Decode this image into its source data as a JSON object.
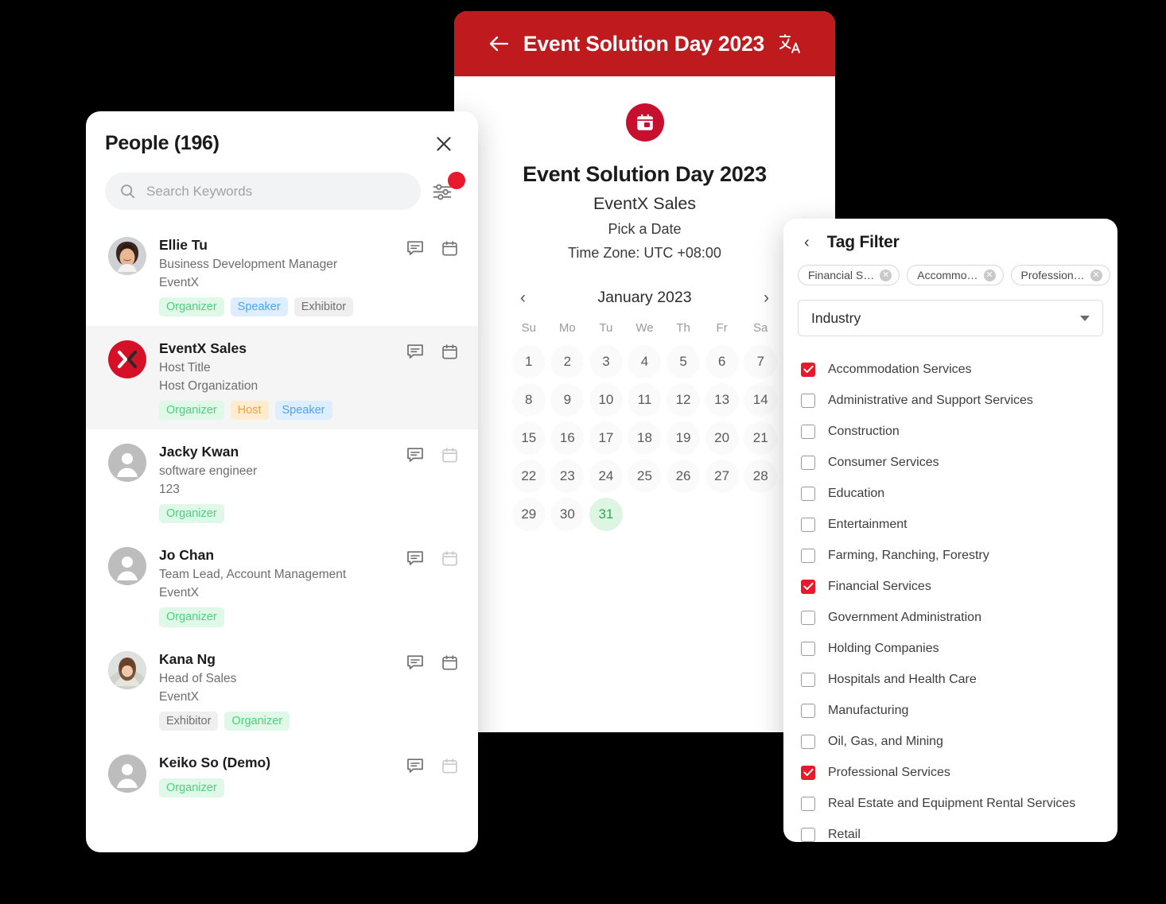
{
  "people_panel": {
    "title": "People (196)",
    "close_icon": "close-icon",
    "search": {
      "placeholder": "Search Keywords",
      "value": "",
      "icon": "search-icon",
      "filter_icon": "sliders-filter-icon",
      "filter_badge": true
    },
    "people": [
      {
        "name": "Ellie Tu",
        "title": "Business Development Manager",
        "org": "EventX",
        "avatar": "photo",
        "highlight": false,
        "tags": [
          {
            "label": "Organizer",
            "kind": "organizer"
          },
          {
            "label": "Speaker",
            "kind": "speaker"
          },
          {
            "label": "Exhibitor",
            "kind": "exhibitor"
          }
        ]
      },
      {
        "name": "EventX Sales",
        "title": "Host Title",
        "org": "Host Organization",
        "avatar": "eventx",
        "highlight": true,
        "tags": [
          {
            "label": "Organizer",
            "kind": "organizer"
          },
          {
            "label": "Host",
            "kind": "host"
          },
          {
            "label": "Speaker",
            "kind": "speaker"
          }
        ]
      },
      {
        "name": "Jacky Kwan",
        "title": "software engineer",
        "org": "123",
        "avatar": "generic",
        "highlight": false,
        "tags": [
          {
            "label": "Organizer",
            "kind": "organizer"
          }
        ]
      },
      {
        "name": "Jo Chan",
        "title": "Team Lead, Account Management",
        "org": "EventX",
        "avatar": "generic",
        "highlight": false,
        "tags": [
          {
            "label": "Organizer",
            "kind": "organizer"
          }
        ]
      },
      {
        "name": "Kana Ng",
        "title": "Head of Sales",
        "org": "EventX",
        "avatar": "photo2",
        "highlight": false,
        "tags": [
          {
            "label": "Exhibitor",
            "kind": "exhibitor"
          },
          {
            "label": "Organizer",
            "kind": "organizer"
          }
        ]
      },
      {
        "name": "Keiko So (Demo)",
        "title": "",
        "org": "",
        "avatar": "generic",
        "highlight": false,
        "tags": [
          {
            "label": "Organizer",
            "kind": "organizer"
          }
        ]
      }
    ],
    "row_actions": [
      "chat-icon",
      "calendar-icon"
    ]
  },
  "event_panel": {
    "header": {
      "back_icon": "back-arrow-icon",
      "title": "Event Solution Day 2023",
      "translate_icon": "translate-icon"
    },
    "badge_icon": "calendar-badge-icon",
    "title": "Event Solution Day 2023",
    "subtitle": "EventX Sales",
    "prompt": "Pick a Date",
    "timezone": "Time Zone: UTC +08:00",
    "calendar": {
      "prev_label": "‹",
      "next_label": "›",
      "month_label": "January 2023",
      "dow": [
        "Su",
        "Mo",
        "Tu",
        "We",
        "Th",
        "Fr",
        "Sa"
      ],
      "lead_blanks": 0,
      "days": [
        1,
        2,
        3,
        4,
        5,
        6,
        7,
        8,
        9,
        10,
        11,
        12,
        13,
        14,
        15,
        16,
        17,
        18,
        19,
        20,
        21,
        22,
        23,
        24,
        25,
        26,
        27,
        28,
        29,
        30,
        31
      ],
      "selected_day": 31
    }
  },
  "tag_filter_panel": {
    "back_icon": "chevron-left-icon",
    "title": "Tag Filter",
    "chips": [
      {
        "label": "Financial S…",
        "remove_icon": "chip-remove-icon"
      },
      {
        "label": "Accommo…",
        "remove_icon": "chip-remove-icon"
      },
      {
        "label": "Profession…",
        "remove_icon": "chip-remove-icon"
      }
    ],
    "select": {
      "value": "Industry",
      "caret_icon": "chevron-down-icon"
    },
    "options": [
      {
        "label": "Accommodation Services",
        "checked": true
      },
      {
        "label": "Administrative and Support Services",
        "checked": false
      },
      {
        "label": "Construction",
        "checked": false
      },
      {
        "label": "Consumer Services",
        "checked": false
      },
      {
        "label": "Education",
        "checked": false
      },
      {
        "label": "Entertainment",
        "checked": false
      },
      {
        "label": "Farming, Ranching, Forestry",
        "checked": false
      },
      {
        "label": "Financial Services",
        "checked": true
      },
      {
        "label": "Government Administration",
        "checked": false
      },
      {
        "label": "Holding Companies",
        "checked": false
      },
      {
        "label": "Hospitals and Health Care",
        "checked": false
      },
      {
        "label": "Manufacturing",
        "checked": false
      },
      {
        "label": "Oil, Gas, and Mining",
        "checked": false
      },
      {
        "label": "Professional Services",
        "checked": true
      },
      {
        "label": "Real Estate and Equipment Rental Services",
        "checked": false
      },
      {
        "label": "Retail",
        "checked": false
      }
    ]
  },
  "colors": {
    "brand_red": "#bf1a1e",
    "accent_red": "#e8192c",
    "logo_red": "#d61127",
    "organizer_green": "#4ad07f",
    "speaker_blue": "#4da3f5",
    "host_orange": "#f4a03c",
    "exhibitor_gray": "#6f6f6f",
    "selected_day_green": "#2fa84f",
    "page_background": "#000000"
  }
}
